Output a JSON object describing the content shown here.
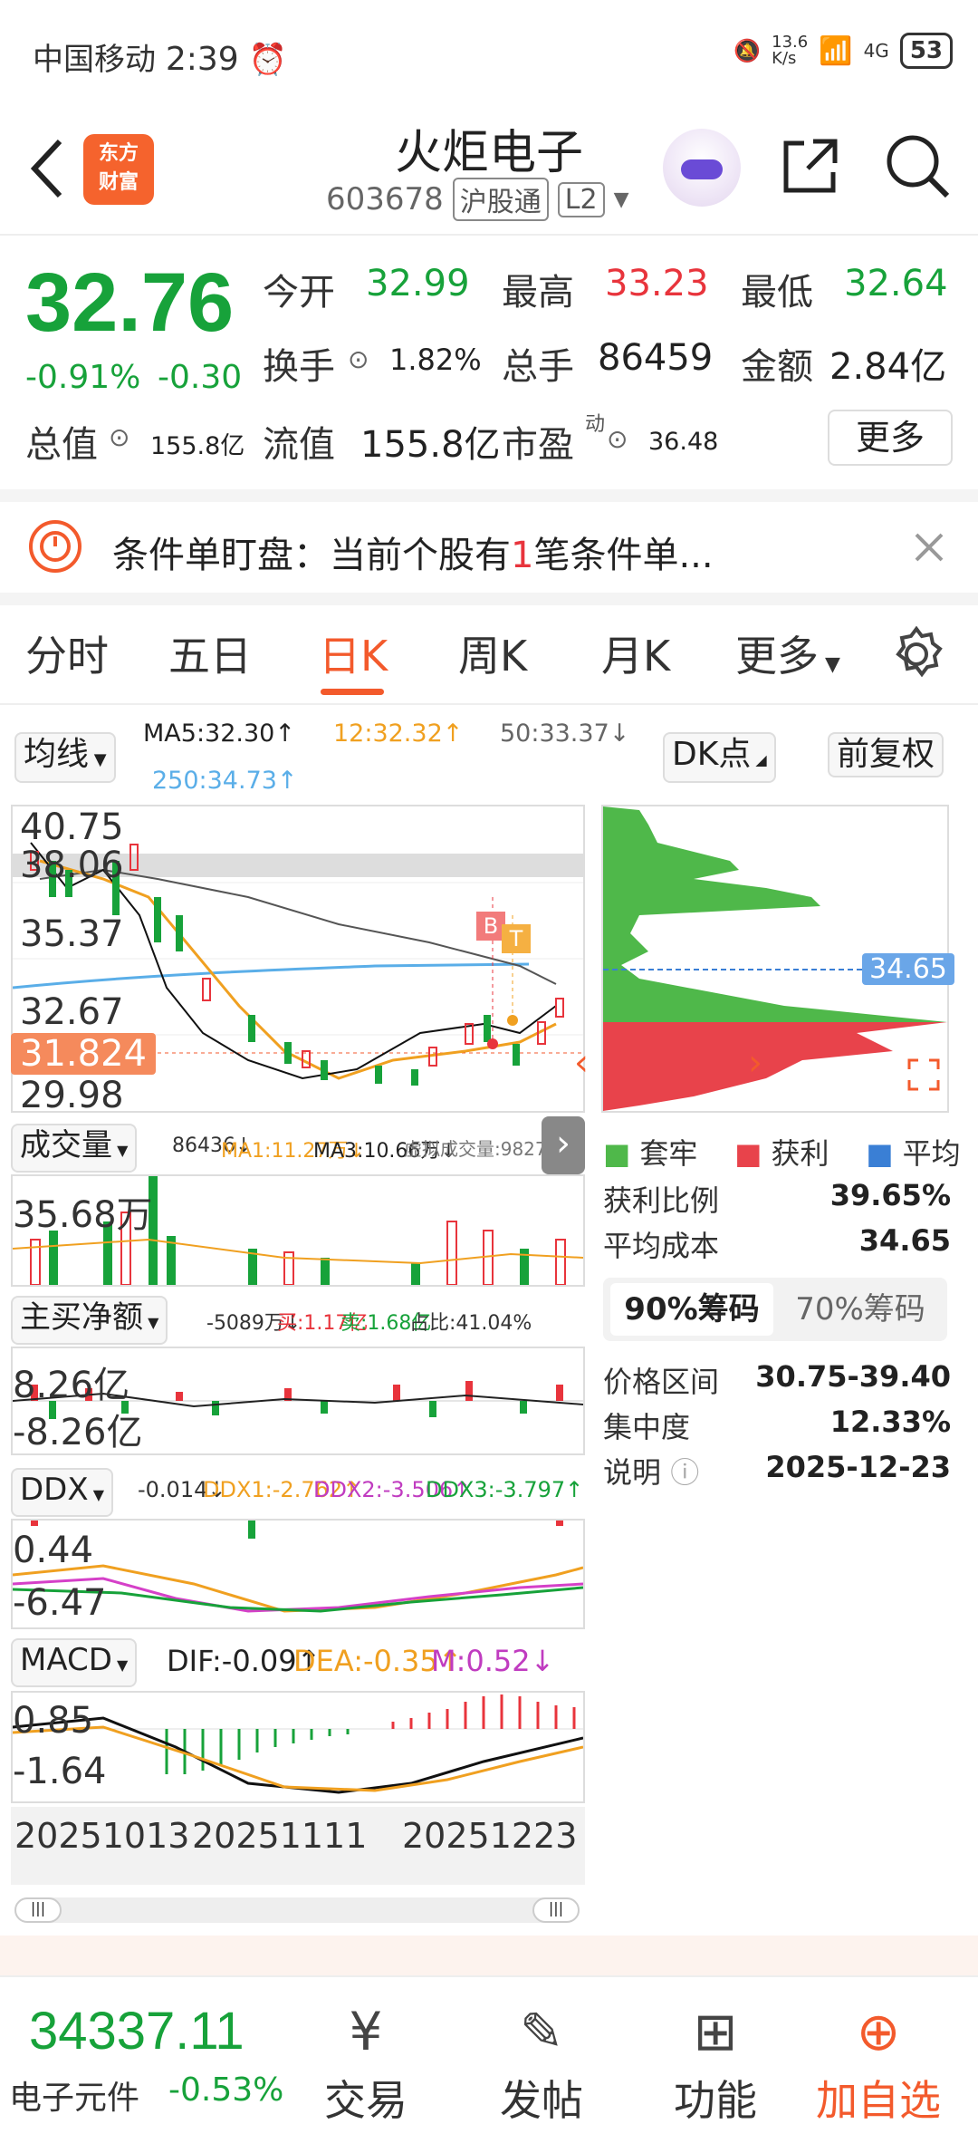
{
  "status_bar": {
    "carrier": "中国移动",
    "time": "2:39",
    "net_speed": "13.6\nK/s",
    "network": "4G",
    "battery": "53"
  },
  "header": {
    "logo_text": "东方\n财富",
    "title": "火炬电子",
    "code": "603678",
    "tag1": "沪股通",
    "tag2": "L2"
  },
  "quote": {
    "price": "32.76",
    "change_pct": "-0.91%",
    "change": "-0.30",
    "open_label": "今开",
    "open": "32.99",
    "high_label": "最高",
    "high": "33.23",
    "low_label": "最低",
    "low": "32.64",
    "turnover_label": "换手",
    "turnover": "1.82%",
    "volume_label": "总手",
    "volume": "86459",
    "amount_label": "金额",
    "amount": "2.84亿",
    "mktcap_label": "总值",
    "mktcap": "155.8亿",
    "float_label": "流值",
    "float": "155.8亿",
    "pe_label": "市盈",
    "pe_sup": "动",
    "pe": "36.48",
    "more_label": "更多"
  },
  "alert": {
    "prefix": "条件单盯盘：当前个股有",
    "count": "1",
    "suffix": "笔条件单..."
  },
  "tabs": [
    {
      "label": "分时"
    },
    {
      "label": "五日"
    },
    {
      "label": "日K",
      "active": true
    },
    {
      "label": "周K"
    },
    {
      "label": "月K"
    },
    {
      "label": "更多"
    }
  ],
  "chart_toolbar": {
    "ma_btn": "均线",
    "ma5": "MA5:32.30↑",
    "ma12": "12:32.32↑",
    "ma50": "50:33.37↓",
    "ma250": "250:34.73↑",
    "dk_btn": "DK点",
    "adjust_btn": "前复权"
  },
  "kline": {
    "axis_labels": [
      "40.75",
      "38.06",
      "35.37",
      "32.67",
      "29.98"
    ],
    "current_price_tag": "31.824",
    "marker_b": "B",
    "marker_t": "T"
  },
  "volume": {
    "selector": "成交量",
    "vol": "86436↓",
    "ma1": "MA1:11.27万↓",
    "ma3": "MA3:10.66万↓",
    "virtual": "虚拟成交量:98275",
    "axis": "35.68万"
  },
  "net_buy": {
    "selector": "主买净额",
    "value": "-5089万↓",
    "buy": "买:1.17亿",
    "sell": "卖:1.68亿",
    "ratio": "占比:41.04%",
    "axis_top": "8.26亿",
    "axis_bottom": "-8.26亿"
  },
  "ddx": {
    "selector": "DDX",
    "value": "-0.014↓",
    "ddx1": "DDX1:-2.762↑",
    "ddx2": "DDX2:-3.506↑",
    "ddx3": "DDX3:-3.797↑",
    "axis_top": "0.44",
    "axis_bottom": "-6.47"
  },
  "macd": {
    "selector": "MACD",
    "dif": "DIF:-0.09↑",
    "dea": "DEA:-0.35↑",
    "m": "M:0.52↓",
    "axis_top": "0.85",
    "axis_bottom": "-1.64"
  },
  "dates": [
    "20251013",
    "20251111",
    "20251223"
  ],
  "chip": {
    "price_tag": "34.65",
    "legend": [
      "套牢",
      "获利",
      "平均"
    ],
    "rows": [
      {
        "label": "获利比例",
        "value": "39.65%"
      },
      {
        "label": "平均成本",
        "value": "34.65"
      }
    ],
    "tab1": "90%筹码",
    "tab2": "70%筹码",
    "rows2": [
      {
        "label": "价格区间",
        "value": "30.75-39.40"
      },
      {
        "label": "集中度",
        "value": "12.33%"
      },
      {
        "label": "说明",
        "value": "2025-12-23"
      }
    ]
  },
  "bottom": {
    "index_value": "34337.11",
    "index_name": "电子元件",
    "index_change": "-0.53%",
    "nav": [
      {
        "label": "交易"
      },
      {
        "label": "发帖"
      },
      {
        "label": "功能"
      },
      {
        "label": "加自选"
      }
    ]
  },
  "colors": {
    "up": "#e8343c",
    "down": "#17a23a",
    "accent": "#f35a2c",
    "ma250": "#5aaee8",
    "ma5": "#222222",
    "ma12": "#f0a020"
  }
}
